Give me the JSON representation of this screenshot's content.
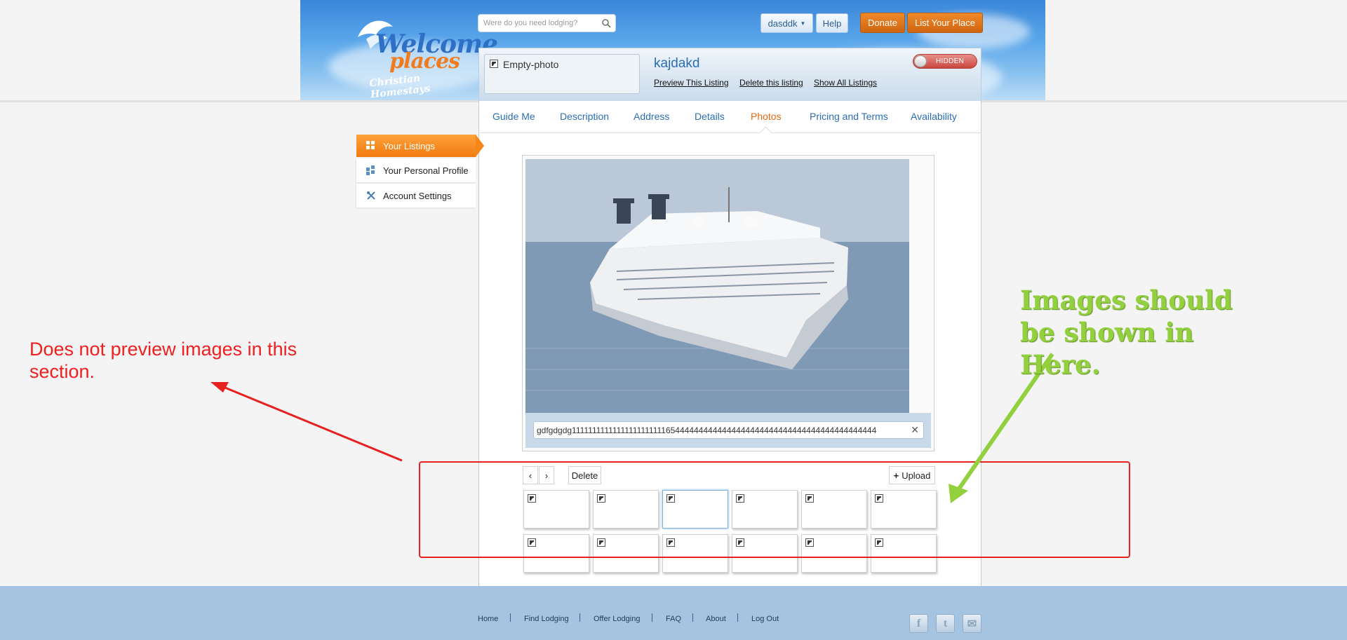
{
  "header": {
    "logo": {
      "line1": "Welcome",
      "line2": "places",
      "line3": "Christian Homestays"
    },
    "search_placeholder": "Were do you need lodging?",
    "user_menu": "dasddk",
    "help": "Help",
    "donate": "Donate",
    "list_your_place": "List Your Place"
  },
  "listing": {
    "photo_label": "Empty-photo",
    "title": "kajdakd",
    "links": {
      "preview": "Preview This Listing",
      "delete": "Delete this listing",
      "show_all": "Show All Listings"
    },
    "visibility": "HIDDEN"
  },
  "tabs": [
    "Guide Me",
    "Description",
    "Address",
    "Details",
    "Photos",
    "Pricing and Terms",
    "Availability"
  ],
  "active_tab": "Photos",
  "sidebar": {
    "items": [
      {
        "label": "Your Listings",
        "icon": "grid-icon",
        "active": true
      },
      {
        "label": "Your Personal Profile",
        "icon": "grid-icon",
        "active": false
      },
      {
        "label": "Account Settings",
        "icon": "tools-icon",
        "active": false
      }
    ]
  },
  "photo": {
    "subject": "cruise ship at sea",
    "caption": "gdfgdgdg11111111111111111111111654444444444444444444444444444444444444444444"
  },
  "gallery": {
    "delete": "Delete",
    "upload": "Upload",
    "thumb_count": 12,
    "selected_thumb": 3
  },
  "annotations": {
    "red_note": "Does not preview images in this section.",
    "green_note": "Images should be shown in Here.",
    "red_color": "#ee2020",
    "green_color": "#93d03e"
  },
  "footer": {
    "links": [
      "Home",
      "Find Lodging",
      "Offer Lodging",
      "FAQ",
      "About",
      "Log Out"
    ],
    "social": [
      "facebook-icon",
      "twitter-icon",
      "mail-icon"
    ]
  },
  "colors": {
    "accent_orange": "#f07b12",
    "link_blue": "#2b6db3",
    "footer_blue": "#a5c4e2"
  }
}
